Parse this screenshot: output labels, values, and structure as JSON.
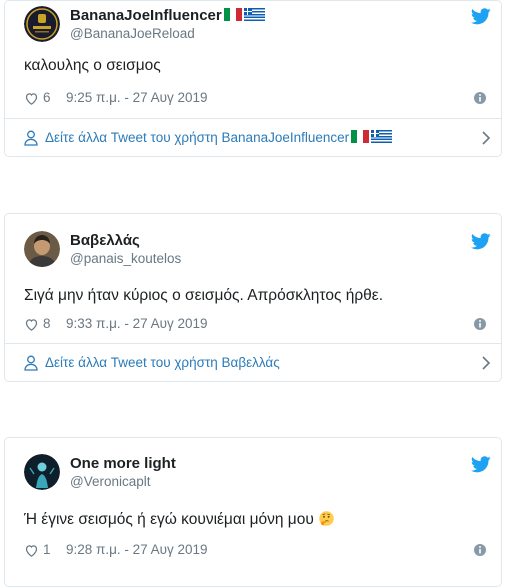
{
  "tweets": [
    {
      "name": "BananaJoeInfluencer",
      "handle": "@BananaJoeReload",
      "text": "καλουλης ο σεισμος",
      "likes": "6",
      "time": "9:25 π.μ. - 27 Αυγ 2019",
      "more_link": "Δείτε άλλα Tweet του χρήστη BananaJoeInfluencer",
      "name_flags": [
        "italy-flag",
        "greece-flag"
      ]
    },
    {
      "name": "Βαβελλάς",
      "handle": "@panais_koutelos",
      "text": "Σιγά μην ήταν κύριος ο σεισμός. Απρόσκλητος ήρθε.",
      "likes": "8",
      "time": "9:33 π.μ. - 27 Αυγ 2019",
      "more_link": "Δείτε άλλα Tweet του χρήστη Βαβελλάς"
    },
    {
      "name": "One more light",
      "handle": "@Veronicaplt",
      "text": "Ή έγινε σεισμός ή εγώ κουνιέμαι μόνη μου",
      "likes": "1",
      "time": "9:28 π.μ. - 27 Αυγ 2019",
      "text_emoji": "thinking-face-emoji"
    }
  ],
  "icons": {
    "bird": "twitter-bird-icon",
    "heart": "heart-icon",
    "info": "info-icon",
    "person": "person-icon",
    "chevron": "chevron-right-icon"
  },
  "colors": {
    "link": "#2b7bb9",
    "twitter_blue": "#1da1f2",
    "meta_gray": "#697882",
    "border": "#e1e8ed"
  }
}
